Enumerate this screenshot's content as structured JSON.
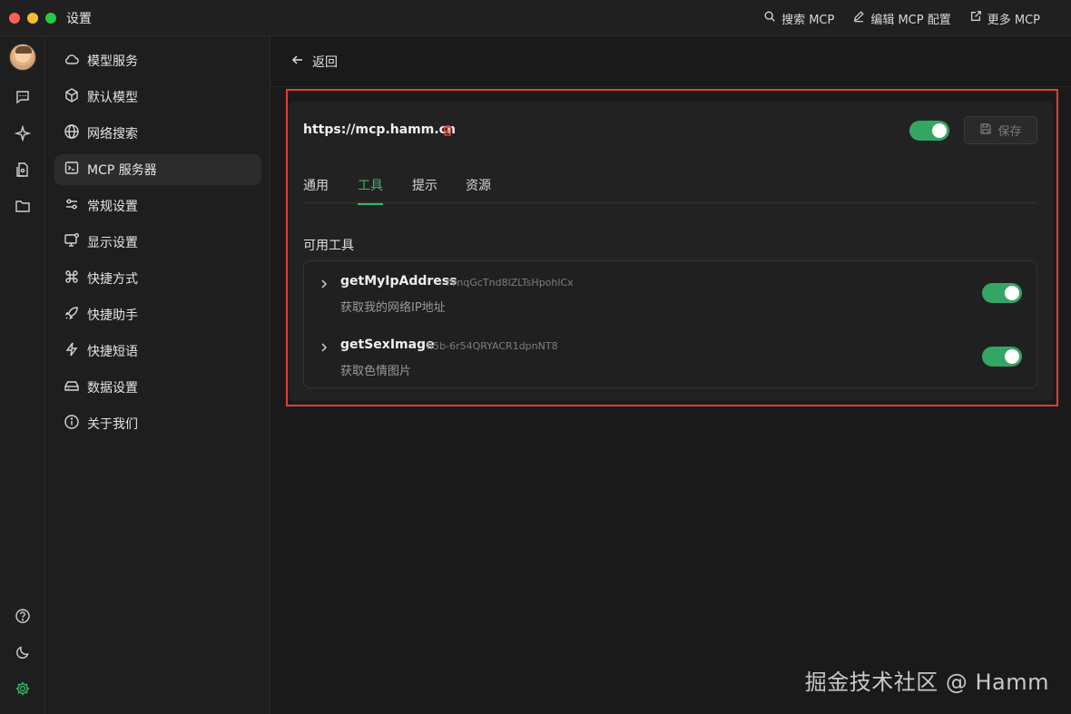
{
  "window": {
    "title": "设置"
  },
  "titlebar": {
    "actions": [
      {
        "label": "搜索 MCP",
        "icon": "search-icon"
      },
      {
        "label": "编辑 MCP 配置",
        "icon": "edit-icon"
      },
      {
        "label": "更多 MCP",
        "icon": "external-link-icon"
      }
    ],
    "status_icon": "check-circle-icon"
  },
  "rail": {
    "top_icons": [
      "chat-icon",
      "sparkle-icon",
      "document-icon",
      "folder-icon"
    ],
    "bottom_icons": [
      "help-icon",
      "moon-icon",
      "settings-icon"
    ]
  },
  "sidebar": {
    "items": [
      {
        "label": "模型服务",
        "icon": "cloud-icon"
      },
      {
        "label": "默认模型",
        "icon": "cube-icon"
      },
      {
        "label": "网络搜索",
        "icon": "globe-icon"
      },
      {
        "label": "MCP 服务器",
        "icon": "terminal-icon",
        "active": true
      },
      {
        "label": "常规设置",
        "icon": "sliders-icon"
      },
      {
        "label": "显示设置",
        "icon": "monitor-icon"
      },
      {
        "label": "快捷方式",
        "icon": "command-icon"
      },
      {
        "label": "快捷助手",
        "icon": "rocket-icon"
      },
      {
        "label": "快捷短语",
        "icon": "zap-icon"
      },
      {
        "label": "数据设置",
        "icon": "drive-icon"
      },
      {
        "label": "关于我们",
        "icon": "info-icon"
      }
    ]
  },
  "main": {
    "back_label": "返回",
    "server": {
      "url": "https://mcp.hamm.cn",
      "enabled": true,
      "save_label": "保存"
    },
    "tabs": [
      {
        "label": "通用",
        "active": false
      },
      {
        "label": "工具",
        "active": true
      },
      {
        "label": "提示",
        "active": false
      },
      {
        "label": "资源",
        "active": false
      }
    ],
    "section_title": "可用工具",
    "tools": [
      {
        "name": "getMyIpAddress",
        "id": "fVnqGcTnd8lZLTsHpohlCx",
        "description": "获取我的网络IP地址",
        "enabled": true
      },
      {
        "name": "getSexImage",
        "id": "fI5b-6r54QRYACR1dpnNT8",
        "description": "获取色情图片",
        "enabled": true
      }
    ]
  },
  "watermark": "掘金技术社区 @ Hamm",
  "colors": {
    "accent": "#39b56b",
    "toggle_on": "#35a563",
    "highlight": "#e43b3b",
    "danger": "#e5533d"
  }
}
